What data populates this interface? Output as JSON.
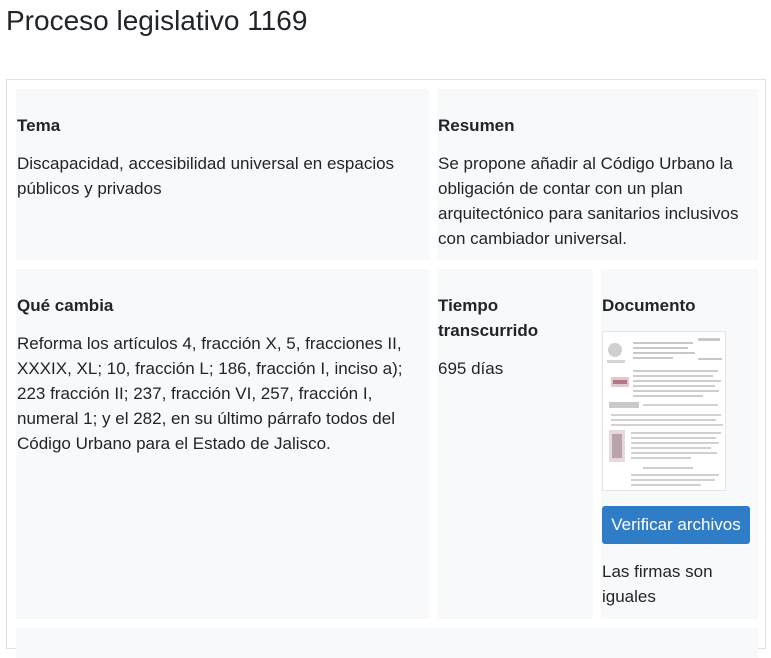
{
  "page": {
    "title": "Proceso legislativo 1169"
  },
  "tema": {
    "heading": "Tema",
    "text": "Discapacidad, accesibilidad universal en espacios públicos y privados"
  },
  "resumen": {
    "heading": "Resumen",
    "text": "Se propone añadir al Código Urbano la obligación de contar con un plan arquitectónico para sanitarios inclusivos con cambiador universal."
  },
  "cambia": {
    "heading": "Qué cambia",
    "text": "Reforma los artículos 4, fracción X, 5, fracciones II, XXXIX, XL; 10, fracción L; 186, fracción I, inciso a); 223 fracción II; 237, fracción VI, 257, fracción I, numeral 1; y el 282, en su último párrafo todos del Código Urbano para el Estado de Jalisco."
  },
  "tiempo": {
    "heading": "Tiempo transcurrido",
    "value": "695 días"
  },
  "documento": {
    "heading": "Documento",
    "button_label": "Verificar archivos",
    "status": "Las firmas son iguales",
    "button_color": "#2f7cc7"
  }
}
